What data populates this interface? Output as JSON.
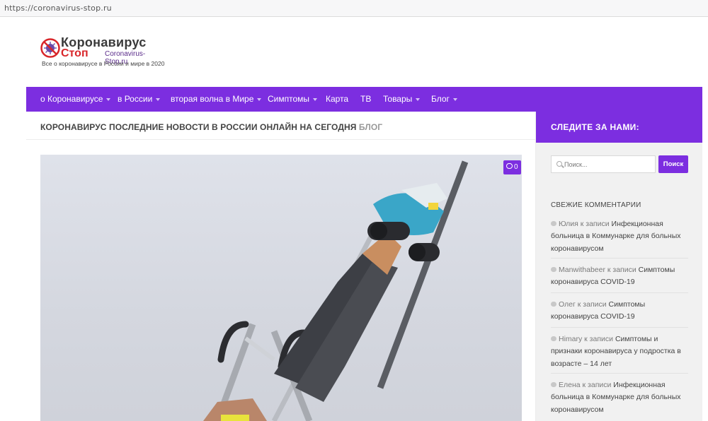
{
  "browser": {
    "url": "https://coronavirus-stop.ru"
  },
  "logo": {
    "title_line1": "Коронавирус",
    "title_line2": "Стоп",
    "domain": "Coronavirus-Stop.ru",
    "tagline": "Все о коронавирусе в России и мире в 2020",
    "icon": "virus-stop-icon"
  },
  "nav": {
    "items": [
      {
        "label": "о Коронавирусе",
        "dropdown": true
      },
      {
        "label": "в России",
        "dropdown": true
      },
      {
        "label": "вторая волна в Мире",
        "dropdown": true
      },
      {
        "label": "Симптомы",
        "dropdown": true
      },
      {
        "label": "Карта",
        "dropdown": false
      },
      {
        "label": "ТВ",
        "dropdown": false
      },
      {
        "label": "Товары",
        "dropdown": true
      },
      {
        "label": "Блог",
        "dropdown": true
      }
    ]
  },
  "main": {
    "heading": "Коронавирус последние новости в России онлайн на сегодня",
    "category": "Блог",
    "comment_count": "0"
  },
  "sidebar": {
    "follow_title": "СЛЕДИТЕ ЗА НАМИ:",
    "search": {
      "placeholder": "Поиск...",
      "button": "Поиск"
    },
    "recent_comments_title": "СВЕЖИЕ КОММЕНТАРИИ",
    "recent_comments": [
      {
        "author": "Юлия",
        "connector": "к записи",
        "post": "Инфекционная больница в Коммунарке для больных коронавирусом"
      },
      {
        "author": "Manwithabeer",
        "connector": "к записи",
        "post": "Симптомы коронавируса COVID-19"
      },
      {
        "author": "Олег",
        "connector": "к записи",
        "post": "Симптомы коронавируса COVID-19"
      },
      {
        "author": "Himary",
        "connector": "к записи",
        "post": "Симптомы и признаки коронавируса у подростка в возрасте – 14 лет"
      },
      {
        "author": "Елена",
        "connector": "к записи",
        "post": "Инфекционная больница в Коммунарке для больных коронавирусом"
      }
    ]
  },
  "colors": {
    "accent": "#7c2ee0",
    "logo_red": "#d8262a"
  }
}
